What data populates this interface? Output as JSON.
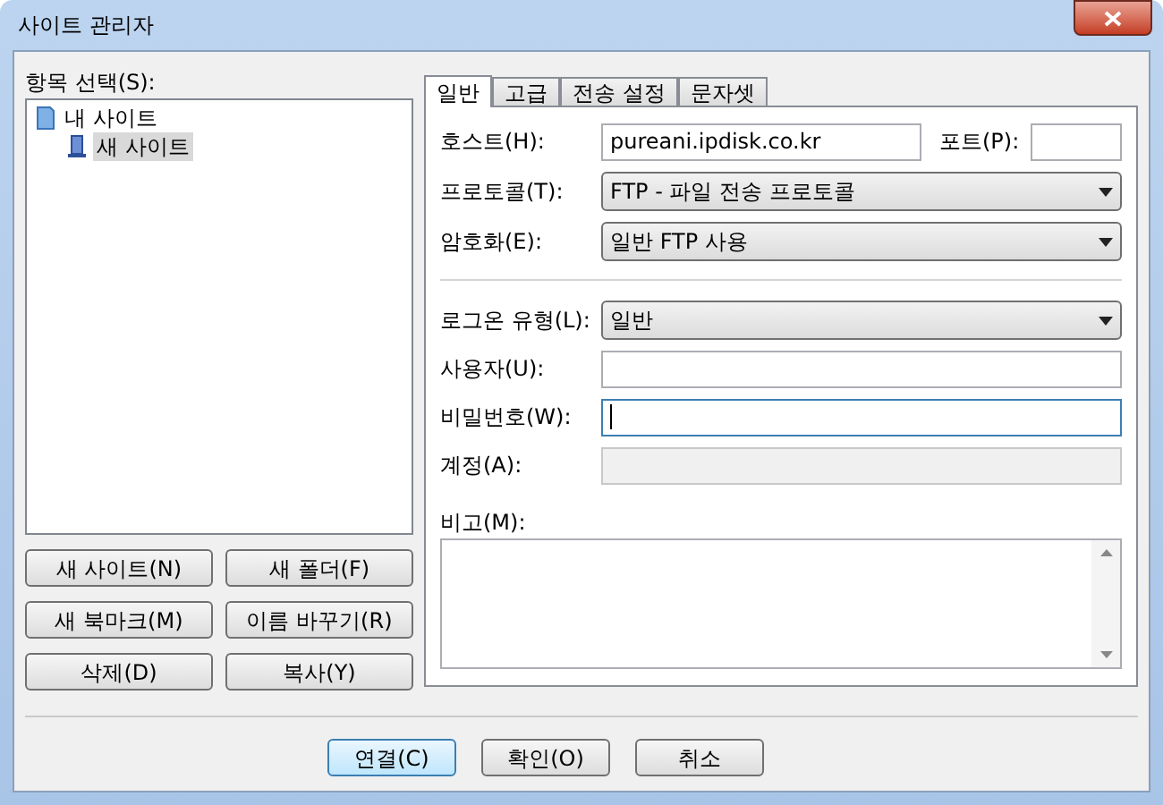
{
  "window": {
    "title": "사이트 관리자"
  },
  "tree": {
    "label": "항목 선택(S):",
    "items": [
      {
        "label": "내 사이트",
        "kind": "folder",
        "selected": false,
        "children": [
          {
            "label": "새 사이트",
            "kind": "site",
            "selected": true
          }
        ]
      }
    ]
  },
  "tree_buttons": [
    "새 사이트(N)",
    "새 폴더(F)",
    "새 북마크(M)",
    "이름 바꾸기(R)",
    "삭제(D)",
    "복사(Y)"
  ],
  "tabs": [
    {
      "label": "일반",
      "selected": true
    },
    {
      "label": "고급",
      "selected": false
    },
    {
      "label": "전송 설정",
      "selected": false
    },
    {
      "label": "문자셋",
      "selected": false
    }
  ],
  "server_fields": [
    {
      "label": "호스트(H):",
      "kind": "text",
      "value": "pureani.ipdisk.co.kr",
      "focused": false,
      "disabled": false,
      "port": {
        "label": "포트(P):"
      }
    },
    {
      "label": "프로토콜(T):",
      "kind": "select",
      "value": "FTP - 파일 전송 프로토콜"
    },
    {
      "label": "암호화(E):",
      "kind": "select",
      "value": "일반 FTP 사용"
    }
  ],
  "login_fields": [
    {
      "label": "로그온 유형(L):",
      "kind": "select",
      "value": "일반"
    },
    {
      "label": "사용자(U):",
      "kind": "text",
      "focused": false,
      "disabled": false
    },
    {
      "label": "비밀번호(W):",
      "kind": "text",
      "focused": true,
      "disabled": false
    },
    {
      "label": "계정(A):",
      "kind": "text",
      "focused": false,
      "disabled": true
    }
  ],
  "comments": {
    "label": "비고(M):"
  },
  "dialog_buttons": [
    {
      "label": "연결(C)",
      "default": true
    },
    {
      "label": "확인(O)",
      "default": false
    },
    {
      "label": "취소",
      "default": false
    }
  ]
}
